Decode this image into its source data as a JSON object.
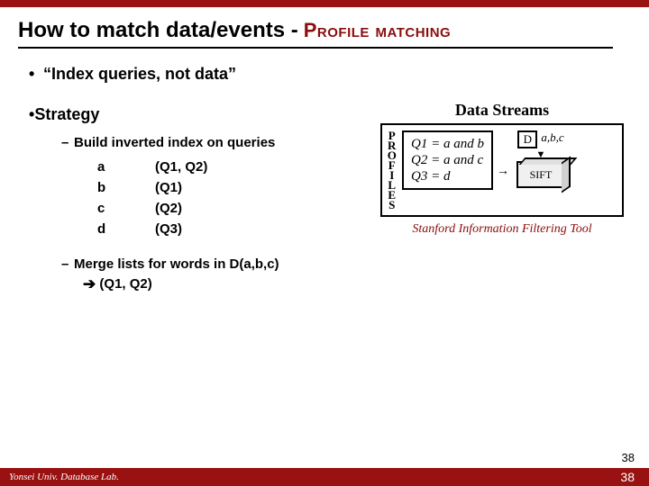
{
  "title": {
    "main": "How to match data/events -",
    "sub": "Profile matching"
  },
  "bullets": {
    "index": "“Index queries, not data”",
    "strategy": "Strategy",
    "build": "Build inverted index on queries",
    "rows": [
      {
        "k": "a",
        "v": "(Q1, Q2)"
      },
      {
        "k": "b",
        "v": "(Q1)"
      },
      {
        "k": "c",
        "v": "(Q2)"
      },
      {
        "k": "d",
        "v": "(Q3)"
      }
    ],
    "merge": "Merge lists for words in D(a,b,c)",
    "merge_result": "(Q1, Q2)"
  },
  "figure": {
    "title": "Data Streams",
    "profiles": "PROFILES",
    "q1": "Q1 = a and b",
    "q2": "Q2 = a and c",
    "q3": "Q3 = d",
    "D": "D",
    "abc": "a,b,c",
    "sift": "SIFT",
    "caption": "Stanford Information Filtering Tool"
  },
  "footer": {
    "lab": "Yonsei Univ. Database Lab.",
    "page": "38",
    "page2": "38"
  }
}
